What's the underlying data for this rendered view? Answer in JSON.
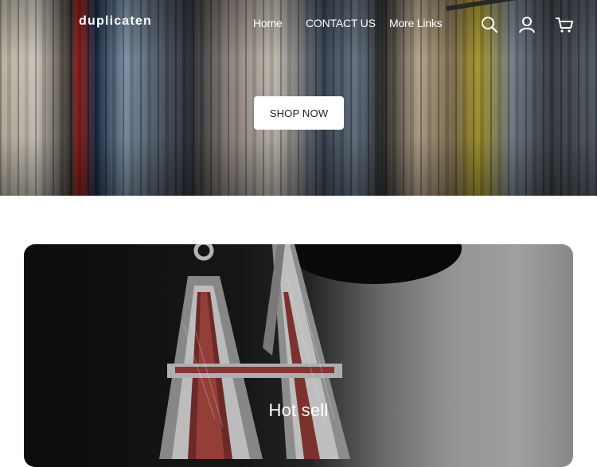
{
  "header": {
    "brand": "duplicaten",
    "nav": [
      {
        "label": "Home"
      },
      {
        "label": "CONTACT US"
      },
      {
        "label": "More Links"
      }
    ],
    "icons": [
      "search-icon",
      "account-icon",
      "cart-icon"
    ]
  },
  "hero": {
    "cta_label": "SHOP NOW"
  },
  "feature": {
    "title": "Hot sell"
  },
  "colors": {
    "nav_text": "#ffffff",
    "button_bg": "#ffffff",
    "button_text": "#1f1f1f"
  }
}
